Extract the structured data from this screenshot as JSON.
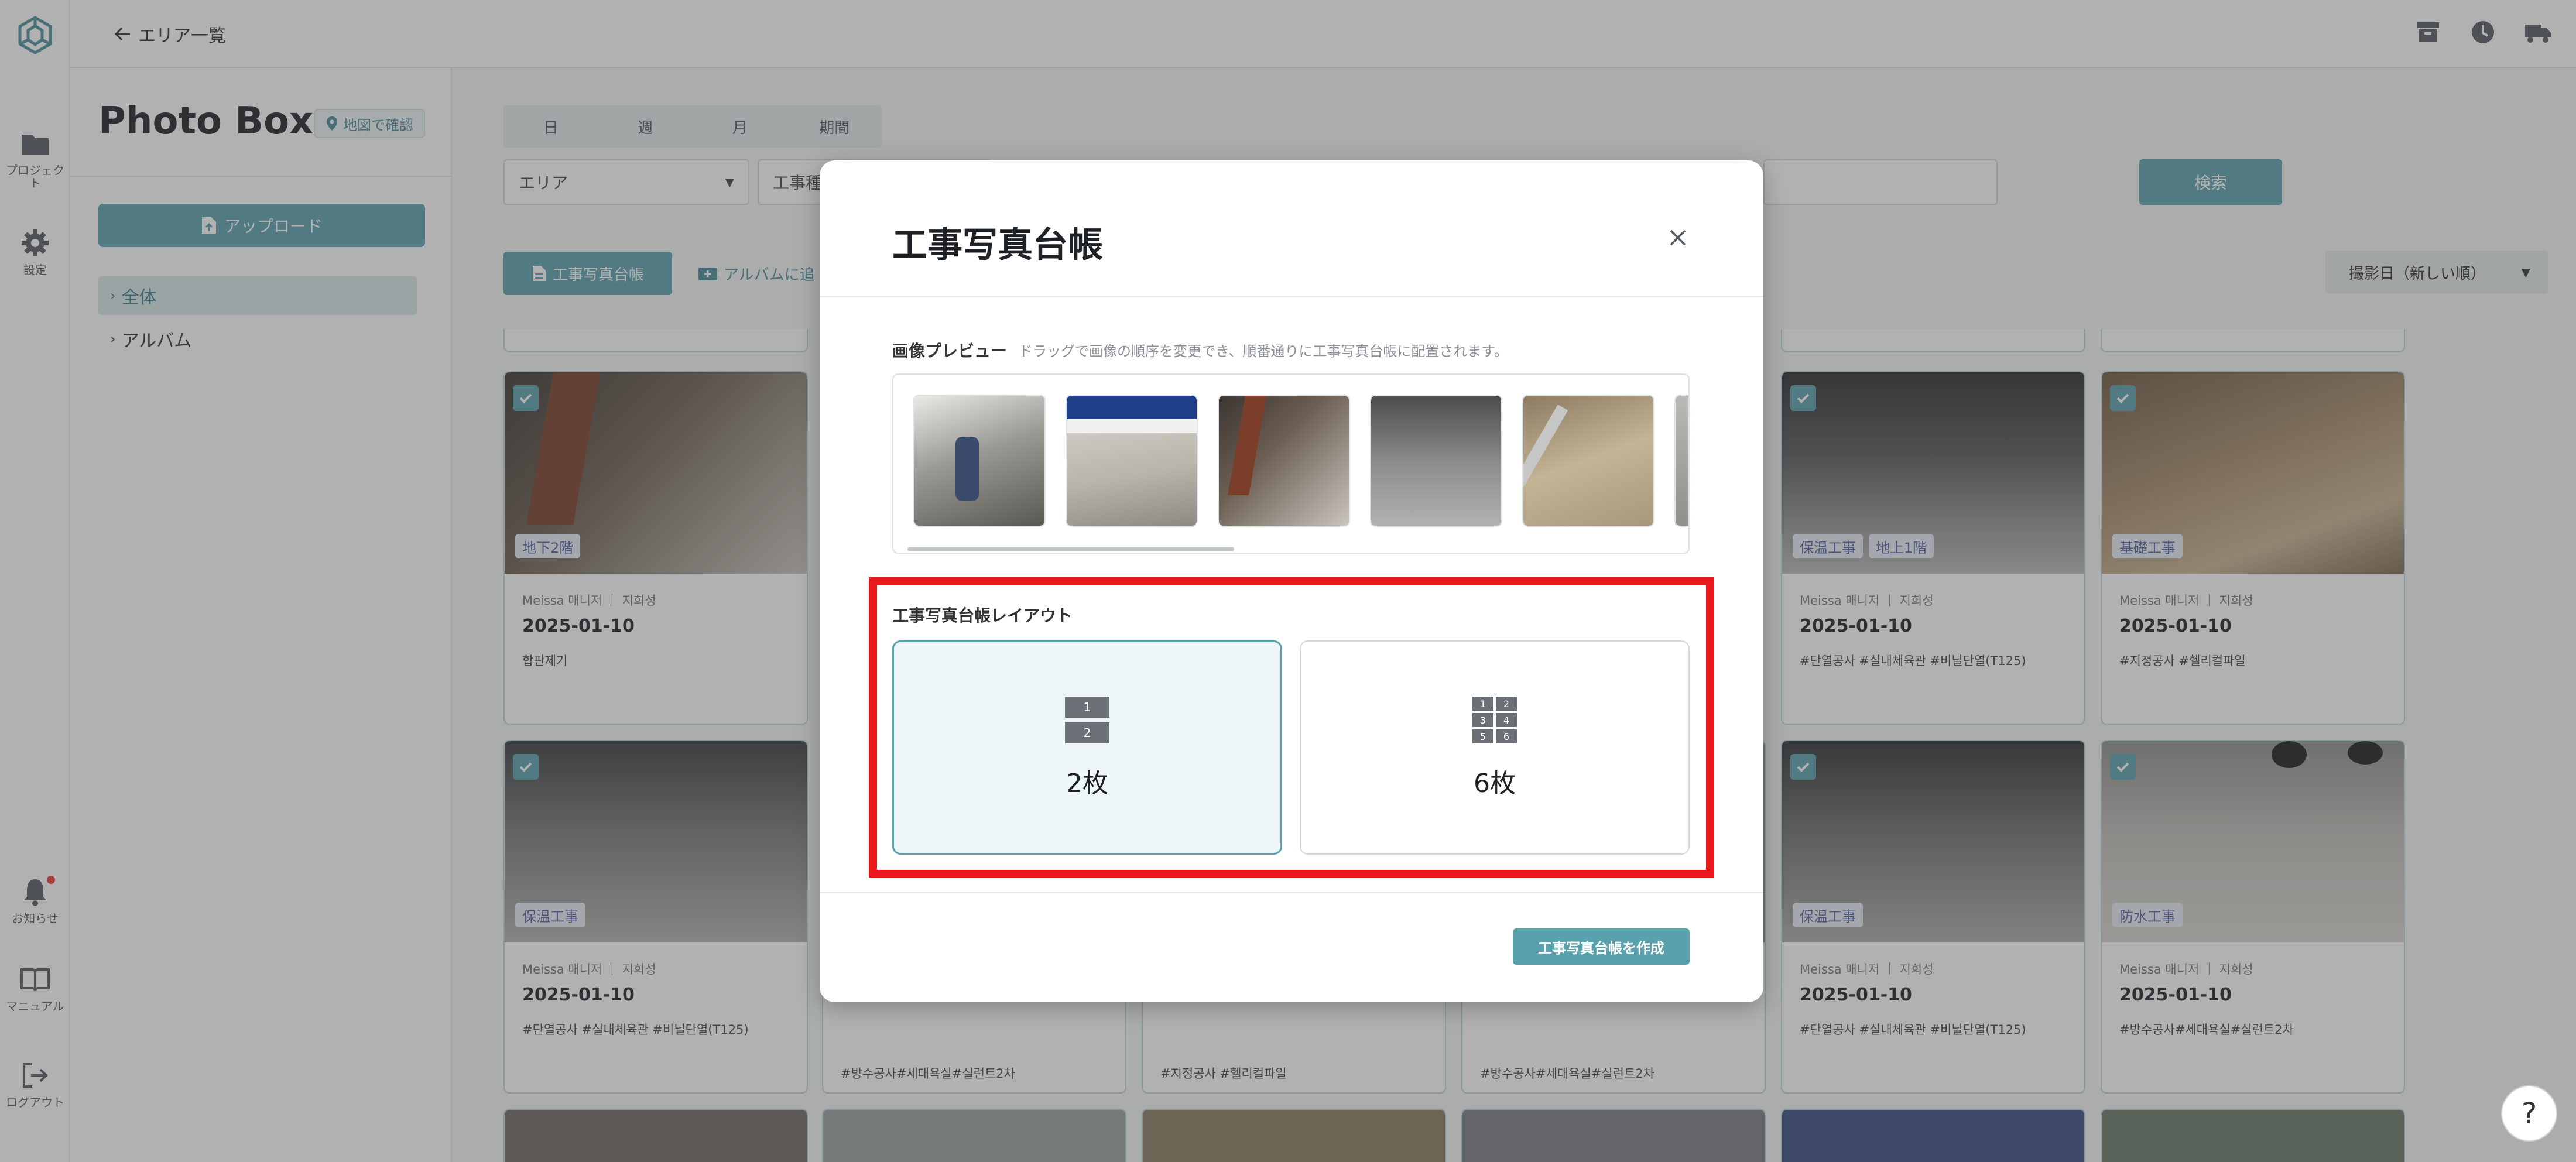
{
  "rail": {
    "items": [
      {
        "label": "プロジェクト",
        "icon": "folder-icon"
      },
      {
        "label": "設定",
        "icon": "gear-icon"
      },
      {
        "label": "お知らせ",
        "icon": "bell-icon"
      },
      {
        "label": "マニュアル",
        "icon": "book-icon"
      },
      {
        "label": "ログアウト",
        "icon": "logout-icon"
      }
    ]
  },
  "topbar": {
    "back_label": "エリア一覧",
    "icons": [
      "archive-icon",
      "clock-icon",
      "truck-icon"
    ]
  },
  "sidebar": {
    "title": "Photo Box",
    "map_chip": "地図で確認",
    "upload_label": "アップロード",
    "tree": [
      {
        "label": "全体",
        "selected": true
      },
      {
        "label": "アルバム",
        "selected": false
      }
    ]
  },
  "filters": {
    "periods": [
      "日",
      "週",
      "月",
      "期間"
    ],
    "area_select": "エリア",
    "koushu_select": "工事種",
    "search_label": "検索"
  },
  "toolbar": {
    "ledger_label": "工事写真台帳",
    "album_add_label": "アルバムに追",
    "sort_label": "撮影日（新しい順）"
  },
  "cards": [
    {
      "tags": [
        "地下2階"
      ],
      "author": "Meissa 매니저 ｜ 지희성",
      "date": "2025-01-10",
      "note": "합판제기"
    },
    {
      "tags": [
        "保温工事",
        "地上1階"
      ],
      "author": "Meissa 매니저 ｜ 지희성",
      "date": "2025-01-10",
      "note": "#단열공사 #실내체육관 #비닐단열(T125)"
    },
    {
      "tags": [
        "基礎工事"
      ],
      "author": "Meissa 매니저 ｜ 지희성",
      "date": "2025-01-10",
      "note": "#지정공사 #헬리컬파일"
    },
    {
      "tags": [
        "保温工事"
      ],
      "author": "Meissa 매니저 ｜ 지희성",
      "date": "2025-01-10",
      "note": "#단열공사 #실내체육관 #비닐단열(T125)"
    },
    {
      "tags": [],
      "author": "",
      "date": "",
      "note": "#방수공사#세대욕실#실런트2차"
    },
    {
      "tags": [],
      "author": "",
      "date": "",
      "note": "#지정공사 #헬리컬파일"
    },
    {
      "tags": [],
      "author": "",
      "date": "",
      "note": "#방수공사#세대욕실#실런트2차"
    },
    {
      "tags": [
        "保温工事"
      ],
      "author": "Meissa 매니저 ｜ 지희성",
      "date": "2025-01-10",
      "note": "#단열공사 #실내체육관 #비닐단열(T125)"
    },
    {
      "tags": [
        "防水工事"
      ],
      "author": "Meissa 매니저 ｜ 지희성",
      "date": "2025-01-10",
      "note": "#방수공사#세대욕실#실런트2차"
    }
  ],
  "modal": {
    "title": "工事写真台帳",
    "preview_label": "画像プレビュー",
    "preview_hint": "ドラッグで画像の順序を変更でき、順番通りに工事写真台帳に配置されます。",
    "layout_label": "工事写真台帳レイアウト",
    "layout_options": [
      {
        "label": "2枚",
        "selected": true
      },
      {
        "label": "6枚",
        "selected": false
      }
    ],
    "create_label": "工事写真台帳を作成"
  },
  "help_label": "?",
  "colors": {
    "accent": "#5aa1ae",
    "highlight": "#e8191c"
  }
}
